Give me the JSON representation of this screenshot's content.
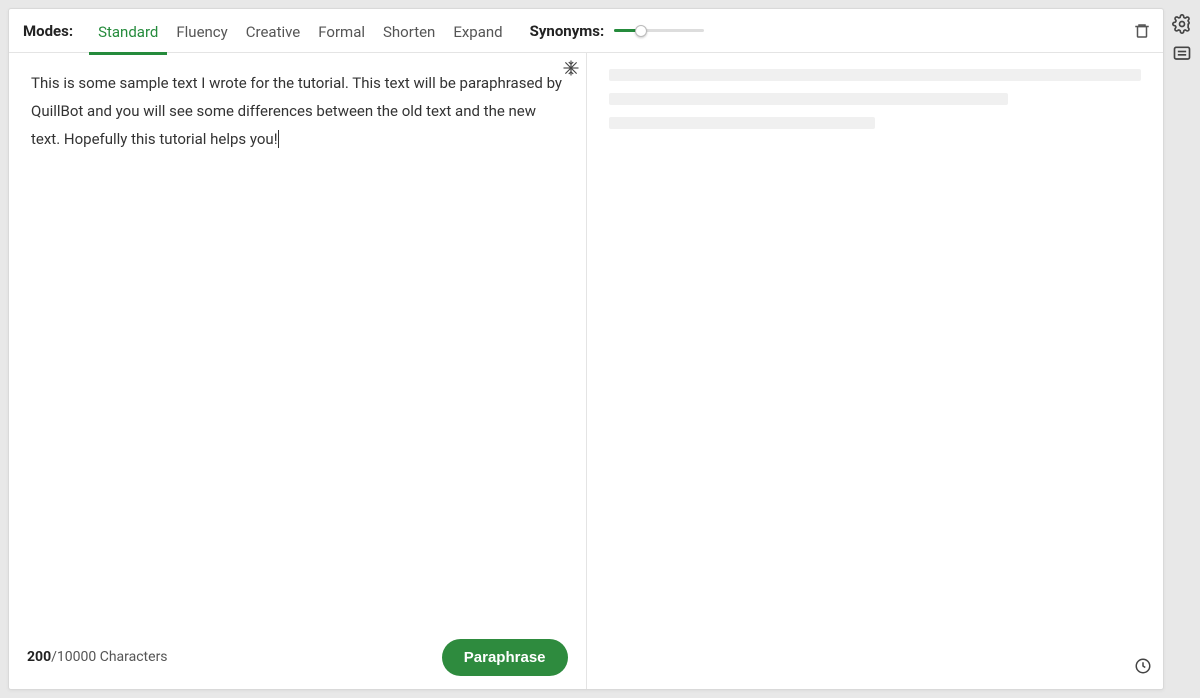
{
  "header": {
    "modes_label": "Modes:",
    "tabs": {
      "standard": "Standard",
      "fluency": "Fluency",
      "creative": "Creative",
      "formal": "Formal",
      "shorten": "Shorten",
      "expand": "Expand"
    },
    "synonyms_label": "Synonyms:",
    "synonyms_value_percent": 30
  },
  "input": {
    "text": "This is some sample text I wrote for the tutorial. This text will be paraphrased by QuillBot and you will see some differences between the old text and the new text. Hopefully this tutorial helps you!"
  },
  "footer": {
    "count_current": "200",
    "count_sep": "/",
    "count_max": "10000",
    "count_label_suffix": " Characters",
    "button_label": "Paraphrase"
  },
  "icons": {
    "trash": "trash-icon",
    "freeze": "freeze-icon",
    "history": "history-icon",
    "settings": "settings-icon",
    "feedback": "feedback-icon"
  }
}
